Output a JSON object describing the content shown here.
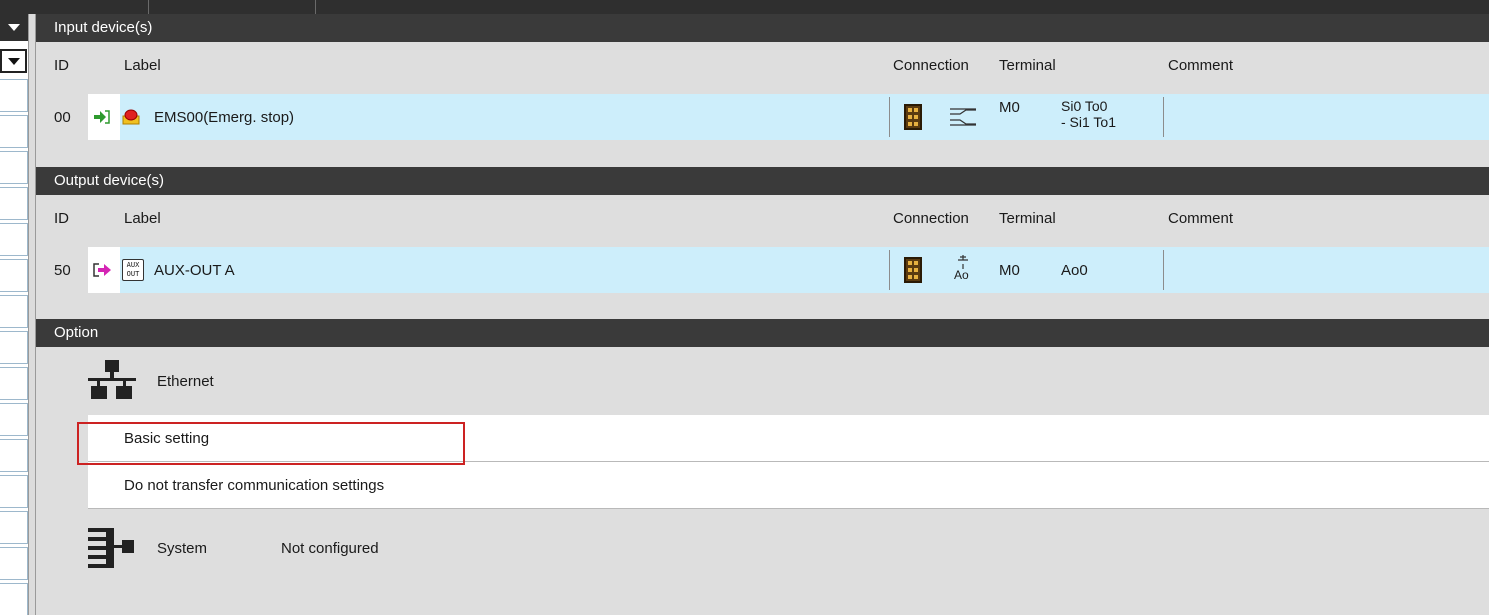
{
  "input_section": {
    "title": "Input device(s)",
    "columns": {
      "id": "ID",
      "label": "Label",
      "connection": "Connection",
      "terminal": "Terminal",
      "comment": "Comment"
    },
    "rows": [
      {
        "id": "00",
        "label": "EMS00(Emerg. stop)",
        "terminal_module": "M0",
        "terminal_line1": "Si0 To0",
        "terminal_line2": "- Si1 To1",
        "comment": ""
      }
    ]
  },
  "output_section": {
    "title": "Output device(s)",
    "columns": {
      "id": "ID",
      "label": "Label",
      "connection": "Connection",
      "terminal": "Terminal",
      "comment": "Comment"
    },
    "rows": [
      {
        "id": "50",
        "label": "AUX-OUT A",
        "terminal_module": "M0",
        "terminal_point": "Ao0",
        "conn_symbol_text": "Ao",
        "comment": ""
      }
    ]
  },
  "option_section": {
    "title": "Option",
    "ethernet_label": "Ethernet",
    "basic_setting": "Basic setting",
    "transfer_setting": "Do not transfer communication settings",
    "system_label": "System",
    "system_value": "Not configured"
  },
  "icons": {
    "input_arrow": "input-arrow-icon",
    "emergency_stop": "emergency-stop-icon",
    "output_arrow": "output-arrow-icon",
    "aux_out": "aux-out-icon",
    "terminal_block": "terminal-block-icon",
    "dual_channel": "dual-channel-icon",
    "contact_symbol": "contact-symbol-icon",
    "ethernet": "ethernet-network-icon",
    "system": "system-network-icon",
    "aux_icon_text_top": "AUX",
    "aux_icon_text_bottom": "OUT"
  },
  "colors": {
    "header_bg": "#3a3a3a",
    "row_bg": "#cdeefb",
    "highlight": "#cc2222",
    "input_arrow": "#2e9a2e",
    "output_arrow": "#d424b4"
  }
}
